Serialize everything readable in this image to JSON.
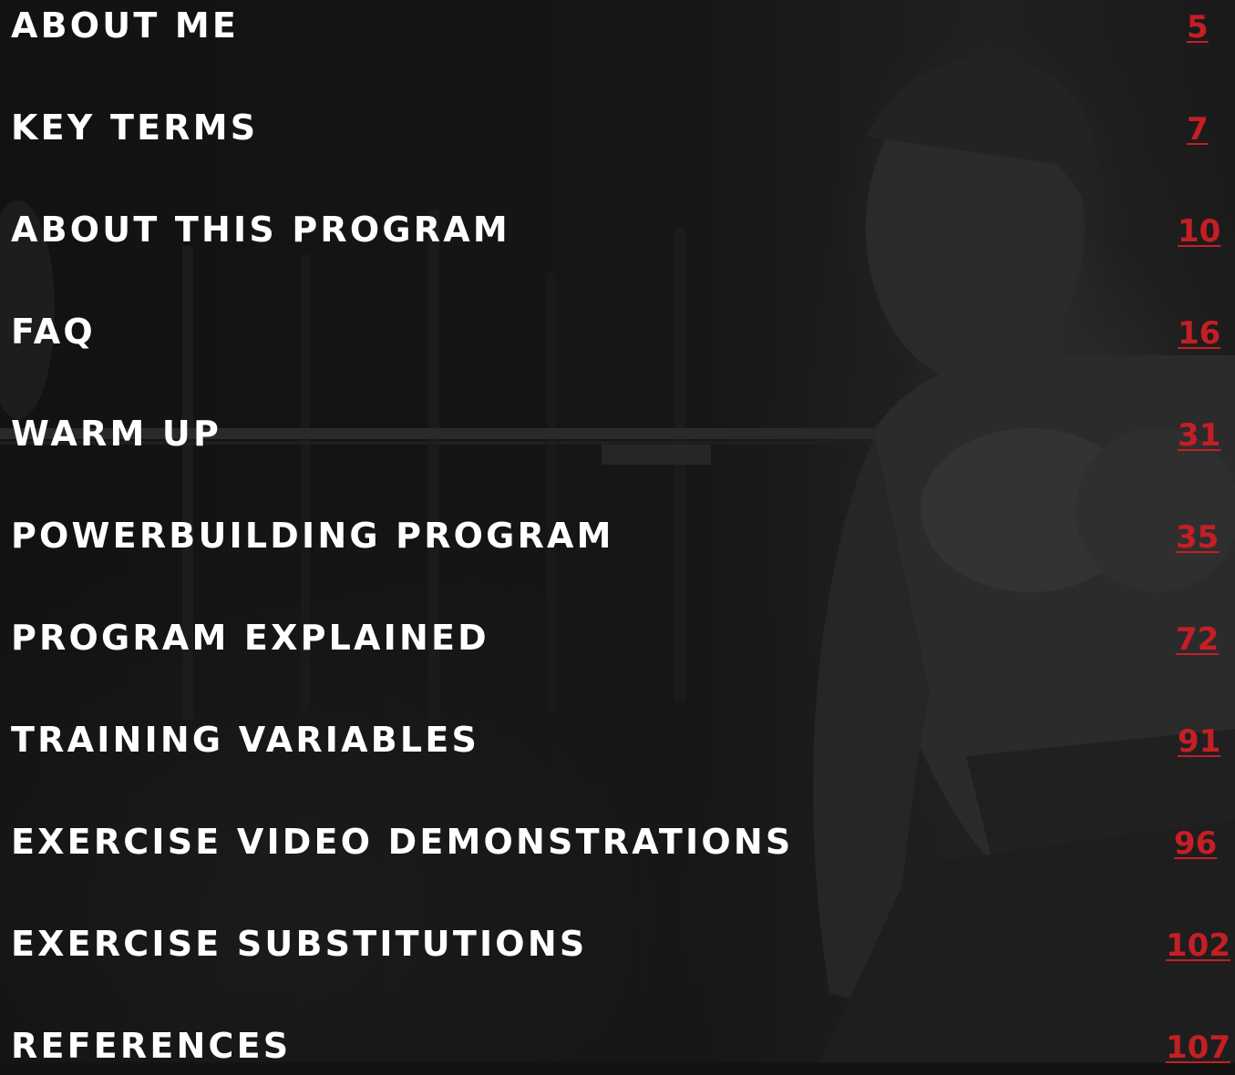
{
  "toc": {
    "entries": [
      {
        "title": "ABOUT ME",
        "page": "5"
      },
      {
        "title": "KEY TERMS",
        "page": "7"
      },
      {
        "title": "ABOUT THIS PROGRAM",
        "page": "10"
      },
      {
        "title": "FAQ",
        "page": "16"
      },
      {
        "title": "WARM UP",
        "page": "31"
      },
      {
        "title": "POWERBUILDING PROGRAM",
        "page": "35"
      },
      {
        "title": "PROGRAM EXPLAINED",
        "page": "72"
      },
      {
        "title": "TRAINING VARIABLES",
        "page": "91"
      },
      {
        "title": "EXERCISE VIDEO DEMONSTRATIONS",
        "page": "96"
      },
      {
        "title": "EXERCISE SUBSTITUTIONS",
        "page": "102"
      },
      {
        "title": "REFERENCES",
        "page": "107"
      }
    ]
  },
  "colors": {
    "background": "#131313",
    "title_text": "#ffffff",
    "page_number": "#c41f24"
  }
}
